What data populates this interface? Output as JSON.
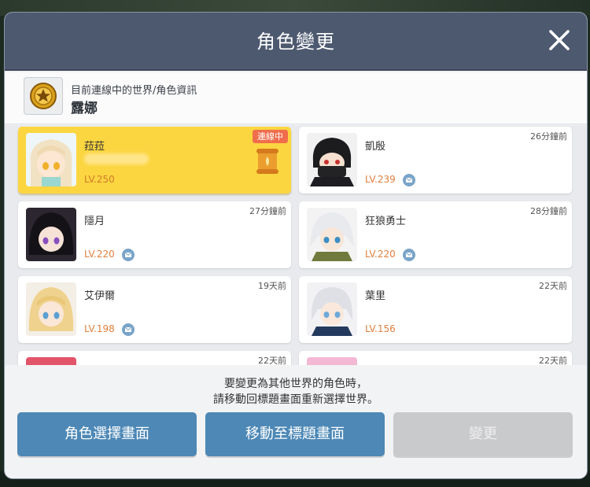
{
  "dialog": {
    "title": "角色變更",
    "current_info_label": "目前連線中的世界/角色資訊",
    "current_character": "露娜"
  },
  "characters": [
    {
      "name": "菈菈",
      "level": "LV.250",
      "status": "連線中",
      "time": ""
    },
    {
      "name": "凱殷",
      "level": "LV.239",
      "status": "",
      "time": "26分鐘前"
    },
    {
      "name": "隱月",
      "level": "LV.220",
      "status": "",
      "time": "27分鐘前"
    },
    {
      "name": "狂狼勇士",
      "level": "LV.220",
      "status": "",
      "time": "28分鐘前"
    },
    {
      "name": "艾伊爾",
      "level": "LV.198",
      "status": "",
      "time": "19天前"
    },
    {
      "name": "葉里",
      "level": "LV.156",
      "status": "",
      "time": "22天前"
    },
    {
      "name": "",
      "level": "",
      "status": "",
      "time": "22天前"
    },
    {
      "name": "",
      "level": "",
      "status": "",
      "time": "22天前"
    }
  ],
  "footer": {
    "notice_line1": "要變更為其他世界的角色時，",
    "notice_line2": "請移動回標題畫面重新選擇世界。",
    "btn_character_select": "角色選擇畫面",
    "btn_title_screen": "移動至標題畫面",
    "btn_change": "變更"
  },
  "background": {
    "percent": "48%"
  },
  "colors": {
    "header": "#4d596f",
    "active_card": "#fcd640",
    "button_blue": "#4d88b6",
    "button_disabled": "#c9cacc",
    "level_text": "#e0803f",
    "online_badge": "#f06d4b"
  }
}
